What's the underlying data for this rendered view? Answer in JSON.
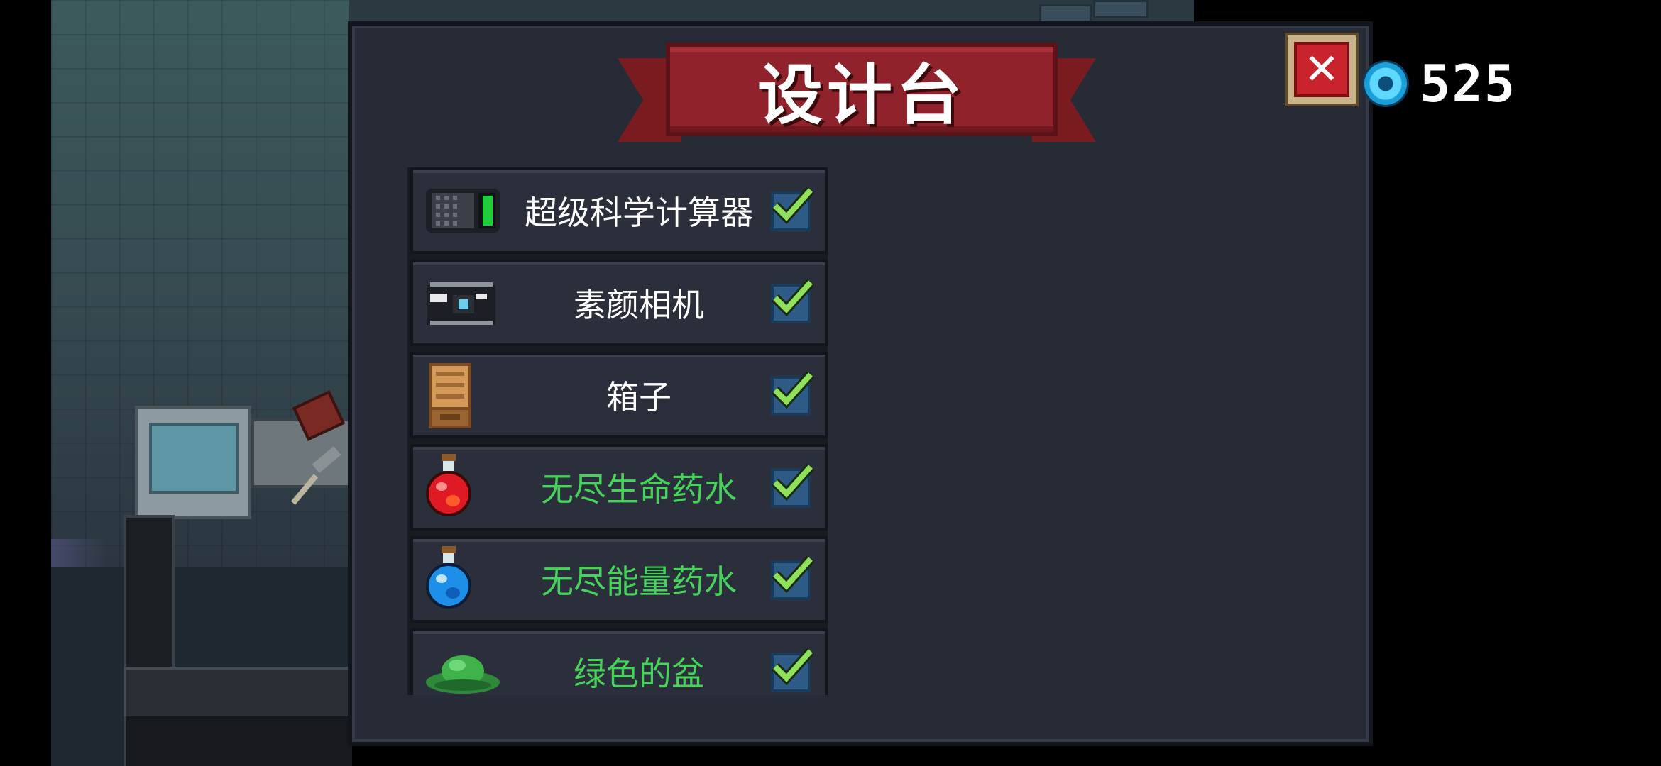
{
  "title": "设计台",
  "currency": {
    "value": "525",
    "icon": "gem-icon"
  },
  "close": {
    "icon": "close-icon",
    "color": "#c9232d"
  },
  "items": [
    {
      "name": "超级科学计算器",
      "color": "#ffffff",
      "icon": "calculator-icon",
      "checked": true
    },
    {
      "name": "素颜相机",
      "color": "#ffffff",
      "icon": "camera-icon",
      "checked": true
    },
    {
      "name": "箱子",
      "color": "#ffffff",
      "icon": "box-icon",
      "checked": true
    },
    {
      "name": "无尽生命药水",
      "color": "#46d35a",
      "icon": "red-potion-icon",
      "checked": true
    },
    {
      "name": "无尽能量药水",
      "color": "#46d35a",
      "icon": "blue-potion-icon",
      "checked": true
    },
    {
      "name": "绿色的盆",
      "color": "#46d35a",
      "icon": "green-pot-icon",
      "checked": true
    }
  ]
}
